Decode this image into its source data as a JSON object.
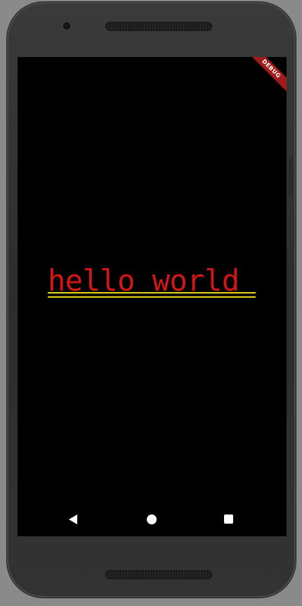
{
  "banner": {
    "label": "DEBUG",
    "color": "#a01b1b"
  },
  "content": {
    "text": "hello world",
    "text_color": "#d31616",
    "decoration": "double-underline",
    "decoration_color": "#e6d419",
    "background": "#000000"
  },
  "navigation_bar": {
    "buttons": [
      {
        "id": "back",
        "icon": "back-triangle-icon"
      },
      {
        "id": "home",
        "icon": "home-circle-icon"
      },
      {
        "id": "recents",
        "icon": "recents-square-icon"
      }
    ]
  }
}
